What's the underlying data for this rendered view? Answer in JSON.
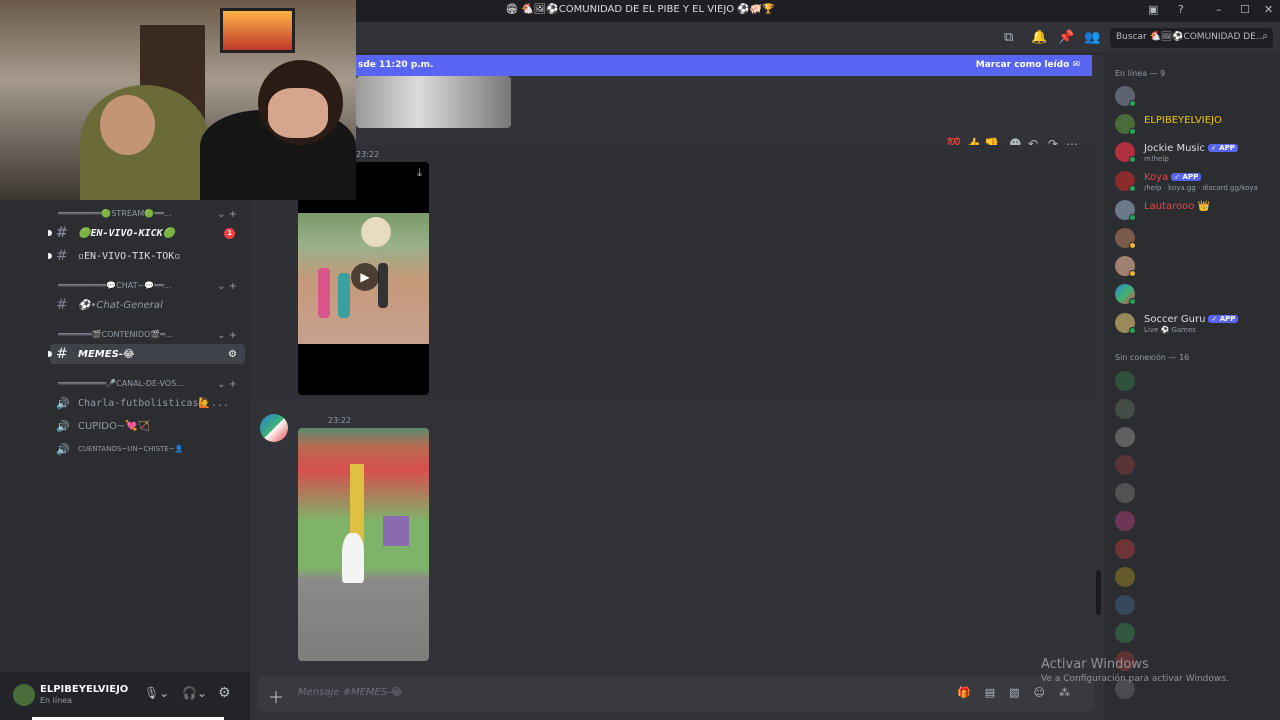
{
  "window": {
    "title": "🏟 🐔🖼⚽COMUNIDAD DE EL PIBE Y EL VIEJO ⚽🐖🏆"
  },
  "topbar": {
    "search_placeholder": "Buscar 🐔🖼⚽COMUNIDAD DE..."
  },
  "banner": {
    "new_since": "sde 11:20 p.m.",
    "mark_read": "Marcar como leído"
  },
  "channels": {
    "cat_stream": "═════════🟢STREAM🟢══...",
    "cat_chat": "══════════💬CHAT~💬══...",
    "cat_contenido": "═══════🎬CONTENIDO🎬═...",
    "cat_canal": "══════════🎤CANAL-DE-VOS...",
    "ch_envivo_kick": "🟢EN-VIVO-KICK🟢",
    "ch_envivo_badge": "1",
    "ch_envivo_tiktok": "▫EN-VIVO-TIK-TOK▫",
    "ch_chat_general": "⚽•Chat-General",
    "ch_memes": "MEMES-😂",
    "vc_charla": "Charla-futbolisticas🙋...",
    "vc_cupido": "CUPIDO~💘🏹",
    "vc_cuentanos": "CUENTANOS~UN~CHISTE~👤"
  },
  "messages": {
    "time1": "23:22",
    "time2": "23:22"
  },
  "user": {
    "name": "ELPIBEYELVIEJO",
    "status": "En línea"
  },
  "composer": {
    "placeholder": "Mensaje #MEMES-😂"
  },
  "members": {
    "online_header": "En línea — 9",
    "offline_header": "Sin conexión — 16",
    "online": [
      {
        "name": "",
        "color": "#5865f2"
      },
      {
        "name": "ELPIBEYELVIEJO",
        "color": "#f0c400"
      },
      {
        "name": "Jockie Music",
        "sub": "m!help",
        "app": "✓ APP",
        "color": "#dbdee1"
      },
      {
        "name": "Koya",
        "sub": "/help · koya.gg · discord.gg/koya",
        "app": "✓ APP",
        "color": "#ed4245"
      },
      {
        "name": "Lautarooo 👑",
        "color": "#ed4245"
      },
      {
        "name": "",
        "color": "#5865f2"
      },
      {
        "name": "",
        "color": "#5865f2"
      },
      {
        "name": "",
        "color": "#5865f2"
      },
      {
        "name": "Soccer Guru",
        "sub": "Live ⚽ Games",
        "app": "✓ APP",
        "color": "#dbdee1"
      }
    ]
  },
  "os": {
    "activate_title": "Activar Windows",
    "activate_sub": "Ve a Configuración para activar Windows."
  }
}
